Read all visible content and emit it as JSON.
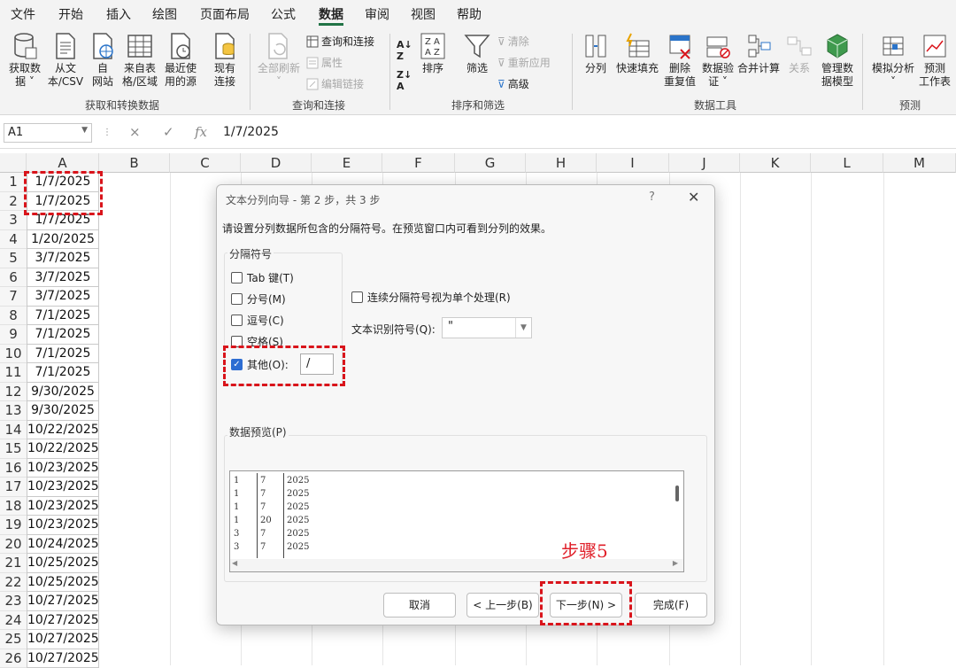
{
  "menu": {
    "tabs": [
      "文件",
      "开始",
      "插入",
      "绘图",
      "页面布局",
      "公式",
      "数据",
      "审阅",
      "视图",
      "帮助"
    ],
    "active_tab": "数据"
  },
  "ribbon": {
    "get_data": {
      "line1": "获取数",
      "line2": "据 ˅"
    },
    "from_csv": {
      "line1": "从文",
      "line2": "本/CSV"
    },
    "from_web": {
      "line1": "自",
      "line2": "网站"
    },
    "from_table": {
      "line1": "来自表",
      "line2": "格/区域"
    },
    "recent_sources": {
      "line1": "最近使",
      "line2": "用的源"
    },
    "existing_conn": {
      "line1": "现有",
      "line2": "连接"
    },
    "group_get_transform": "获取和转换数据",
    "refresh_all": {
      "line1": "全部刷新",
      "line2": "˅"
    },
    "queries_conn": "查询和连接",
    "properties": "属性",
    "edit_links": "编辑链接",
    "group_queries": "查询和连接",
    "sort": "排序",
    "filter": "筛选",
    "clear": "清除",
    "reapply": "重新应用",
    "advanced": "高级",
    "group_sort_filter": "排序和筛选",
    "text_to_columns": "分列",
    "flash_fill": "快速填充",
    "remove_dup": {
      "line1": "删除",
      "line2": "重复值"
    },
    "data_validation": {
      "line1": "数据验",
      "line2": "证 ˅"
    },
    "consolidate": "合并计算",
    "relationships": "关系",
    "data_model": {
      "line1": "管理数",
      "line2": "据模型"
    },
    "group_data_tools": "数据工具",
    "what_if": {
      "line1": "模拟分析",
      "line2": "˅"
    },
    "forecast_sheet": {
      "line1": "预测",
      "line2": "工作表"
    },
    "group_forecast": "预测"
  },
  "formula_bar": {
    "name_box": "A1",
    "cancel_icon": "×",
    "enter_icon": "✓",
    "fx": "fx",
    "content": "1/7/2025"
  },
  "sheet": {
    "columns": [
      "A",
      "B",
      "C",
      "D",
      "E",
      "F",
      "G",
      "H",
      "I",
      "J",
      "K",
      "L",
      "M"
    ],
    "rows": [
      "1",
      "2",
      "3",
      "4",
      "5",
      "6",
      "7",
      "8",
      "9",
      "10",
      "11",
      "12",
      "13",
      "14",
      "15",
      "16",
      "17",
      "18",
      "19",
      "20",
      "21",
      "22",
      "23",
      "24",
      "25",
      "26"
    ],
    "col_a": [
      "1/7/2025",
      "1/7/2025",
      "1/7/2025",
      "1/20/2025",
      "3/7/2025",
      "3/7/2025",
      "3/7/2025",
      "7/1/2025",
      "7/1/2025",
      "7/1/2025",
      "7/1/2025",
      "9/30/2025",
      "9/30/2025",
      "10/22/2025",
      "10/22/2025",
      "10/23/2025",
      "10/23/2025",
      "10/23/2025",
      "10/23/2025",
      "10/24/2025",
      "10/25/2025",
      "10/25/2025",
      "10/27/2025",
      "10/27/2025",
      "10/27/2025",
      "10/27/2025"
    ]
  },
  "dialog": {
    "title": "文本分列向导 - 第 2 步，共 3 步",
    "help": "?",
    "close": "✕",
    "description": "请设置分列数据所包含的分隔符号。在预览窗口内可看到分列的效果。",
    "delimiters_legend": "分隔符号",
    "tab_label": "Tab 键(T)",
    "semicolon_label": "分号(M)",
    "comma_label": "逗号(C)",
    "space_label": "空格(S)",
    "other_label": "其他(O):",
    "other_value": "/",
    "consecutive_label": "连续分隔符号视为单个处理(R)",
    "qualifier_label": "文本识别符号(Q):",
    "qualifier_value": "\"",
    "preview_legend": "数据预览(P)",
    "preview_rows": [
      [
        "1",
        "7",
        "2025"
      ],
      [
        "1",
        "7",
        "2025"
      ],
      [
        "1",
        "7",
        "2025"
      ],
      [
        "1",
        "20",
        "2025"
      ],
      [
        "3",
        "7",
        "2025"
      ],
      [
        "3",
        "7",
        "2025"
      ]
    ],
    "cancel_btn": "取消",
    "back_btn": "< 上一步(B)",
    "next_btn": "下一步(N) >",
    "finish_btn": "完成(F)"
  },
  "annotation": {
    "step_label": "步骤5",
    "color": "#e0202a"
  }
}
